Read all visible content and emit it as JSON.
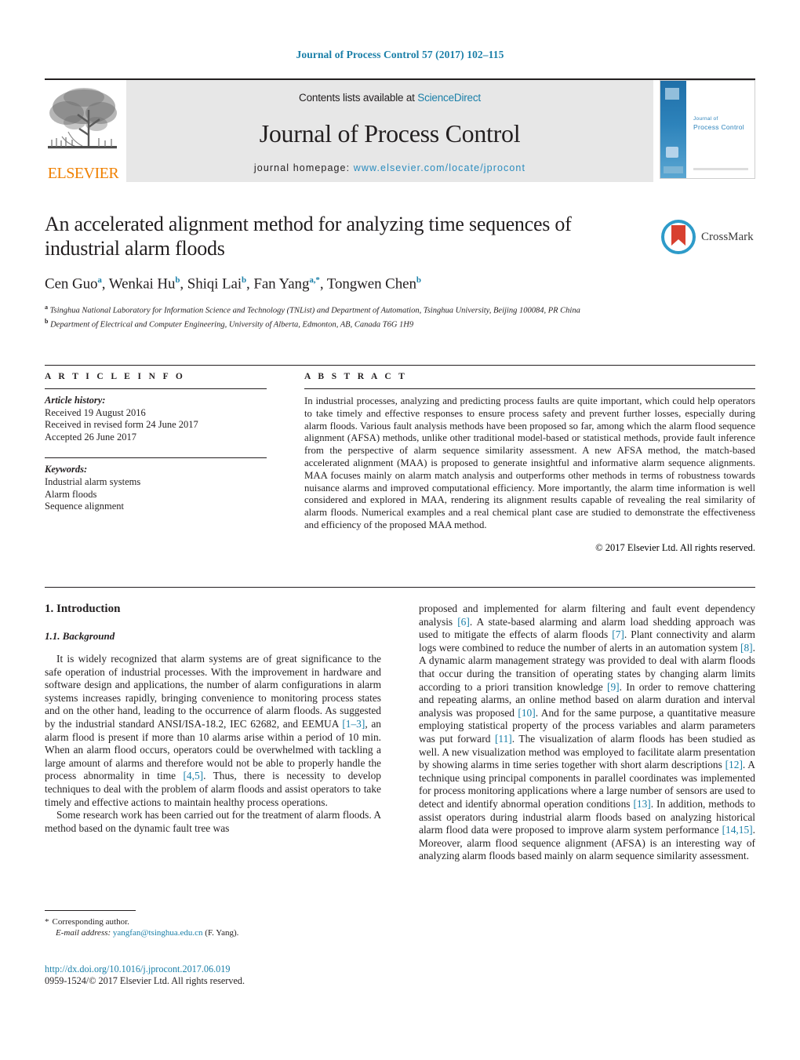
{
  "running_head": "Journal of Process Control 57 (2017) 102–115",
  "masthead": {
    "publisher_wordmark": "ELSEVIER",
    "contents_prefix": "Contents lists available at ",
    "contents_link": "ScienceDirect",
    "journal_title": "Journal of Process Control",
    "homepage_prefix": "journal homepage: ",
    "homepage_url": "www.elsevier.com/locate/jprocont",
    "cover": {
      "line1": "Journal of",
      "line2": "Process Control"
    }
  },
  "article": {
    "title": "An accelerated alignment method for analyzing time sequences of industrial alarm floods",
    "crossmark_label": "CrossMark",
    "authors_html": "Cen Guo<sup>a</sup>, Wenkai Hu<sup>b</sup>, Shiqi Lai<sup>b</sup>, Fan Yang<sup>a,*</sup>, Tongwen Chen<sup>b</sup>",
    "affiliation_a": "Tsinghua National Laboratory for Information Science and Technology (TNList) and Department of Automation, Tsinghua University, Beijing 100084, PR China",
    "affiliation_b": "Department of Electrical and Computer Engineering, University of Alberta, Edmonton, AB, Canada T6G 1H9"
  },
  "article_info": {
    "heading": "A R T I C L E   I N F O",
    "history_label": "Article history:",
    "history": [
      "Received 19 August 2016",
      "Received in revised form 24 June 2017",
      "Accepted 26 June 2017"
    ],
    "keywords_label": "Keywords:",
    "keywords": [
      "Industrial alarm systems",
      "Alarm floods",
      "Sequence alignment"
    ]
  },
  "abstract": {
    "heading": "A B S T R A C T",
    "text": "In industrial processes, analyzing and predicting process faults are quite important, which could help operators to take timely and effective responses to ensure process safety and prevent further losses, especially during alarm floods. Various fault analysis methods have been proposed so far, among which the alarm flood sequence alignment (AFSA) methods, unlike other traditional model-based or statistical methods, provide fault inference from the perspective of alarm sequence similarity assessment. A new AFSA method, the match-based accelerated alignment (MAA) is proposed to generate insightful and informative alarm sequence alignments. MAA focuses mainly on alarm match analysis and outperforms other methods in terms of robustness towards nuisance alarms and improved computational efficiency. More importantly, the alarm time information is well considered and explored in MAA, rendering its alignment results capable of revealing the real similarity of alarm floods. Numerical examples and a real chemical plant case are studied to demonstrate the effectiveness and efficiency of the proposed MAA method.",
    "copyright": "© 2017 Elsevier Ltd. All rights reserved."
  },
  "body": {
    "section_heading": "1. Introduction",
    "subsection_heading": "1.1. Background",
    "left_paragraph_1_html": "It is widely recognized that alarm systems are of great significance to the safe operation of industrial processes. With the improvement in hardware and software design and applications, the number of alarm configurations in alarm systems increases rapidly, bringing convenience to monitoring process states and on the other hand, leading to the occurrence of alarm floods. As suggested by the industrial standard ANSI/ISA-18.2, IEC 62682, and EEMUA <span class=\"ref\">[1–3]</span>, an alarm flood is present if more than 10 alarms arise within a period of 10 min. When an alarm flood occurs, operators could be overwhelmed with tackling a large amount of alarms and therefore would not be able to properly handle the process abnormality in time <span class=\"ref\">[4,5]</span>. Thus, there is necessity to develop techniques to deal with the problem of alarm floods and assist operators to take timely and effective actions to maintain healthy process operations.",
    "left_paragraph_2_html": "Some research work has been carried out for the treatment of alarm floods. A method based on the dynamic fault tree was",
    "right_paragraph_html": "proposed and implemented for alarm filtering and fault event dependency analysis <span class=\"ref\">[6]</span>. A state-based alarming and alarm load shedding approach was used to mitigate the effects of alarm floods <span class=\"ref\">[7]</span>. Plant connectivity and alarm logs were combined to reduce the number of alerts in an automation system <span class=\"ref\">[8]</span>. A dynamic alarm management strategy was provided to deal with alarm floods that occur during the transition of operating states by changing alarm limits according to a priori transition knowledge <span class=\"ref\">[9]</span>. In order to remove chattering and repeating alarms, an online method based on alarm duration and interval analysis was proposed <span class=\"ref\">[10]</span>. And for the same purpose, a quantitative measure employing statistical property of the process variables and alarm parameters was put forward <span class=\"ref\">[11]</span>. The visualization of alarm floods has been studied as well. A new visualization method was employed to facilitate alarm presentation by showing alarms in time series together with short alarm descriptions <span class=\"ref\">[12]</span>. A technique using principal components in parallel coordinates was implemented for process monitoring applications where a large number of sensors are used to detect and identify abnormal operation conditions <span class=\"ref\">[13]</span>. In addition, methods to assist operators during industrial alarm floods based on analyzing historical alarm flood data were proposed to improve alarm system performance <span class=\"ref\">[14,15]</span>. Moreover, alarm flood sequence alignment (AFSA) is an interesting way of analyzing alarm floods based mainly on alarm sequence similarity assessment."
  },
  "footnote": {
    "star": "*",
    "corresponding": "Corresponding author.",
    "email_label": "E-mail address:",
    "email": "yangfan@tsinghua.edu.cn",
    "email_suffix": "(F. Yang)."
  },
  "footer": {
    "doi": "http://dx.doi.org/10.1016/j.jprocont.2017.06.019",
    "issn": "0959-1524/© 2017 Elsevier Ltd. All rights reserved."
  },
  "colors": {
    "link_blue": "#1a7fa8",
    "elsevier_orange": "#f08000",
    "masthead_grey": "#e7e7e7",
    "crossmark_ring": "#2e9bc9",
    "crossmark_red": "#d8402f"
  }
}
